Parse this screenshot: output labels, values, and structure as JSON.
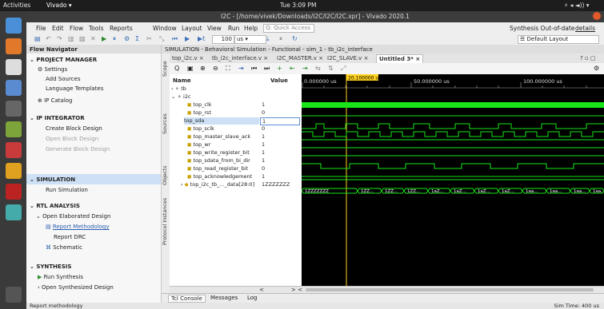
{
  "topbar": {
    "activities": "Activities",
    "app": "Vivado ▾",
    "clock": "Tue 3:09 PM"
  },
  "window": {
    "title": "I2C - [/home/vivek/Downloads/I2C/I2C/I2C.xpr] - Vivado 2020.1"
  },
  "menu": [
    "File",
    "Edit",
    "Flow",
    "Tools",
    "Reports",
    "Window",
    "Layout",
    "View",
    "Run",
    "Help"
  ],
  "quick_access": "Q: Quick Access",
  "synthesis_status": "Synthesis Out-of-date",
  "details": "details",
  "toolbar": {
    "time_value": "100",
    "time_unit": "us",
    "layout": "Default Layout"
  },
  "flow_navigator": {
    "title": "Flow Navigator",
    "project_manager": "PROJECT MANAGER",
    "settings": "Settings",
    "add_sources": "Add Sources",
    "language_templates": "Language Templates",
    "ip_catalog": "IP Catalog",
    "ip_integrator": "IP INTEGRATOR",
    "create_block_design": "Create Block Design",
    "open_block_design": "Open Block Design",
    "generate_block_design": "Generate Block Design",
    "simulation": "SIMULATION",
    "run_simulation": "Run Simulation",
    "rtl_analysis": "RTL ANALYSIS",
    "open_elaborated_design": "Open Elaborated Design",
    "report_methodology": "Report Methodology",
    "report_drc": "Report DRC",
    "schematic": "Schematic",
    "synthesis": "SYNTHESIS",
    "run_synthesis": "Run Synthesis",
    "open_synthesized_design": "Open Synthesized Design"
  },
  "sim_header": "SIMULATION - Behavioral Simulation - Functional - sim_1 - tb_i2c_interface",
  "side_tabs": [
    "Scope",
    "Sources",
    "Objects",
    "Protocol Instances"
  ],
  "tabs": [
    "top_i2c.v",
    "tb_i2c_interface.v",
    "I2C_MASTER.v",
    "I2C_SLAVE.v",
    "Untitled 3*"
  ],
  "columns": {
    "name": "Name",
    "value": "Value"
  },
  "cursor_time": "20.100000 us",
  "ruler": [
    "0.000000 us",
    "50.000000 us",
    "100.000000 us"
  ],
  "signals": [
    {
      "name": "tb",
      "value": ""
    },
    {
      "name": "i2c",
      "value": ""
    },
    {
      "name": "top_clk",
      "value": "1"
    },
    {
      "name": "top_rst",
      "value": "0"
    },
    {
      "name": "top_sda",
      "value": "1"
    },
    {
      "name": "top_sclk",
      "value": "0"
    },
    {
      "name": "top_master_slave_ack",
      "value": "1"
    },
    {
      "name": "top_wr",
      "value": "1"
    },
    {
      "name": "top_write_register_bit",
      "value": "1"
    },
    {
      "name": "top_sdata_from_bi_dir",
      "value": "1"
    },
    {
      "name": "top_read_register_bit",
      "value": "0"
    },
    {
      "name": "top_acknowledgement",
      "value": "1"
    },
    {
      "name": "top_i2c_tb_..._data[28:0]",
      "value": "1ZZZZZZZ"
    }
  ],
  "bus_labels": [
    "1ZZZZZZZ",
    "1ZZ...",
    "1ZZ...",
    "1ZZ...",
    "1aZ...",
    "1aZ...",
    "1aZ...",
    "1aZ...",
    "1aa...",
    "1aa...",
    "1aa...",
    "1aa..."
  ],
  "bottom_tabs": [
    "Tcl Console",
    "Messages",
    "Log"
  ],
  "status": {
    "left": "Report methodology",
    "right": "Sim Time: 400 us"
  },
  "colors": {
    "wave_green": "#19e619",
    "select_blue": "#cde0f5",
    "accent": "#2a5db0"
  }
}
